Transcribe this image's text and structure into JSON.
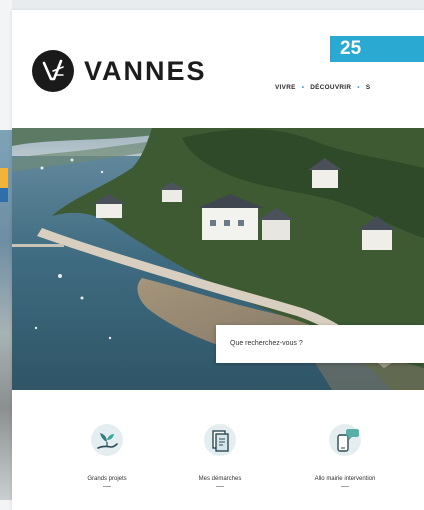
{
  "badge": {
    "text": "25"
  },
  "logo": {
    "text": "VANNES"
  },
  "nav": {
    "items": [
      "VIVRE",
      "DÉCOUVRIR",
      "S"
    ]
  },
  "search": {
    "placeholder": "Que recherchez-vous ?"
  },
  "tiles": [
    {
      "label": "Grands projets",
      "icon": "hand-plant-icon"
    },
    {
      "label": "Mes démarches",
      "icon": "documents-icon"
    },
    {
      "label": "Allo mairie intervention",
      "icon": "phone-chat-icon"
    }
  ],
  "colors": {
    "accent": "#2aa9d3",
    "text": "#1c1c1c"
  }
}
